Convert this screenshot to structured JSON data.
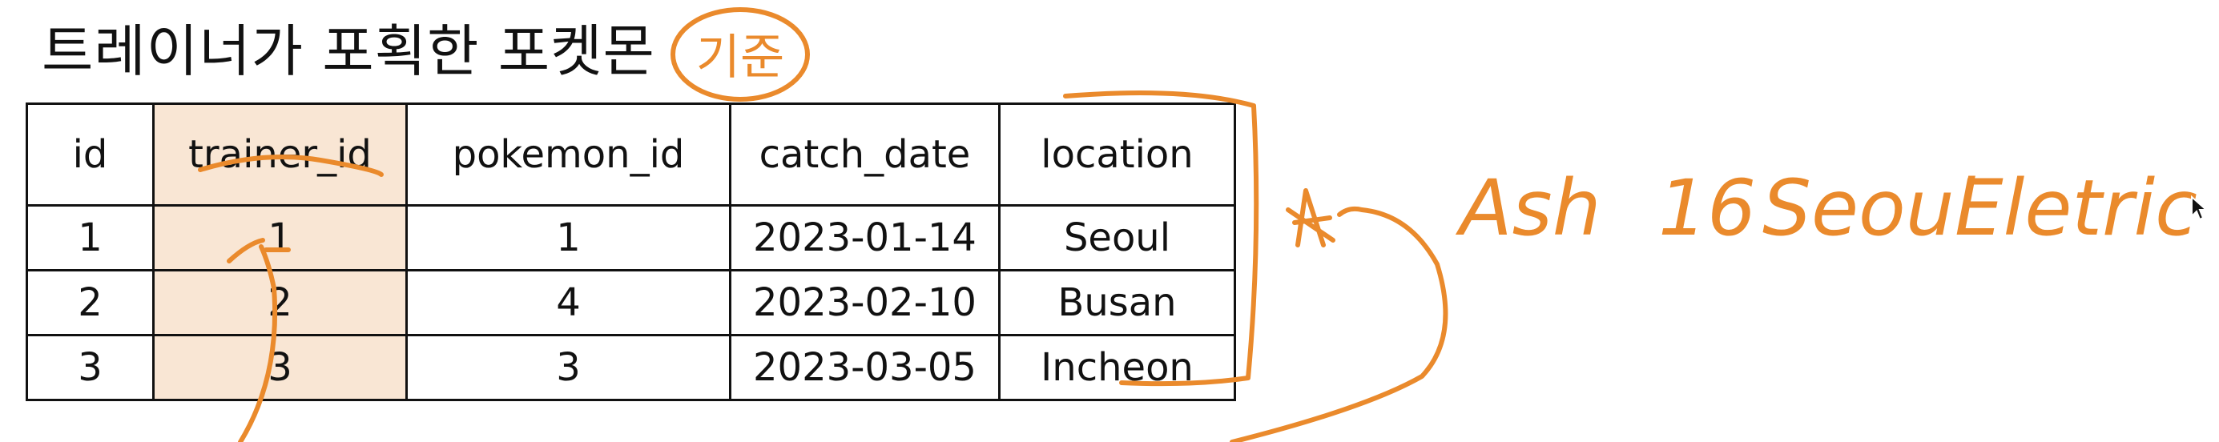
{
  "title": "트레이너가 포획한 포켓몬",
  "table": {
    "headers": [
      "id",
      "trainer_id",
      "pokemon_id",
      "catch_date",
      "location"
    ],
    "rows": [
      [
        "1",
        "1",
        "1",
        "2023-01-14",
        "Seoul"
      ],
      [
        "2",
        "2",
        "4",
        "2023-02-10",
        "Busan"
      ],
      [
        "3",
        "3",
        "3",
        "2023-03-05",
        "Incheon"
      ]
    ],
    "highlight_color": "#f9e6d4"
  },
  "annotations": {
    "color": "#ea8a2c",
    "circled_label": "기준",
    "note_name": "Ash",
    "note_number": "16",
    "note_city": "Seoul",
    "note_type": "Eletric"
  },
  "icons": {
    "cursor": "mouse-pointer-icon"
  }
}
